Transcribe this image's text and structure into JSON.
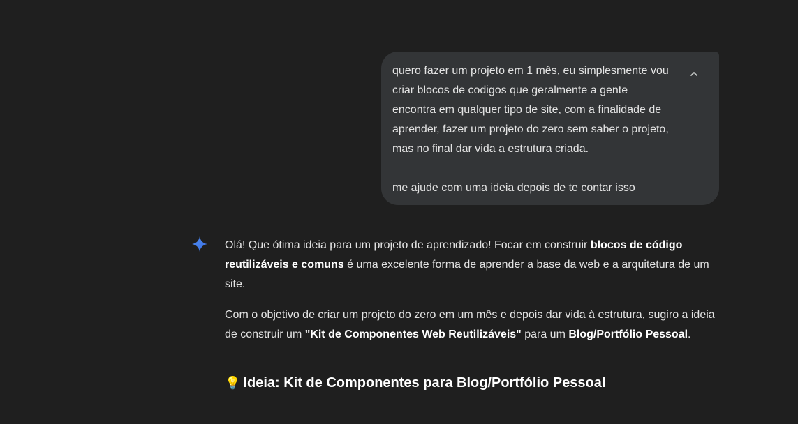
{
  "user_message": {
    "text": "quero fazer um projeto em 1 mês, eu simplesmente vou\ncriar blocos de codigos que geralmente a gente\nencontra em qualquer tipo de site, com a finalidade de\naprender, fazer um projeto do zero sem saber o projeto,\nmas no final dar vida a estrutura criada.\n\nme ajude com uma ideia depois de te contar isso",
    "collapse_icon": "chevron-up-icon"
  },
  "response": {
    "icon": "sparkle-icon",
    "icon_color": "#4285f4",
    "p1": {
      "a": "Olá! Que ótima ideia para um projeto de aprendizado! Focar em construir ",
      "b": "blocos de código reutilizáveis e comuns",
      "c": " é uma excelente forma de aprender a base da web e a arquitetura de um site."
    },
    "p2": {
      "a": "Com o objetivo de criar um projeto do zero em um mês e depois dar vida à estrutura, sugiro a ideia de construir um ",
      "b": "\"Kit de Componentes Web Reutilizáveis\"",
      "c": " para um ",
      "d": "Blog/Portfólio Pessoal",
      "e": "."
    },
    "heading_emoji": "💡",
    "heading": "Ideia: Kit de Componentes para Blog/Portfólio Pessoal"
  }
}
